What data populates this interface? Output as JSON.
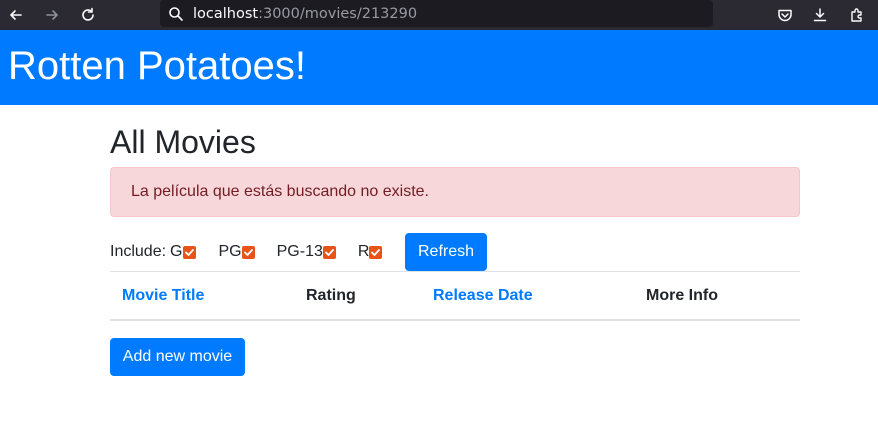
{
  "browser": {
    "url_host": "localhost",
    "url_rest": ":3000/movies/213290"
  },
  "header": {
    "title": "Rotten Potatoes!"
  },
  "main": {
    "page_title": "All Movies",
    "alert_message": "La película que estás buscando no existe.",
    "filter": {
      "label": "Include:",
      "ratings": [
        {
          "label": "G",
          "checked": true
        },
        {
          "label": "PG",
          "checked": true
        },
        {
          "label": "PG-13",
          "checked": true
        },
        {
          "label": "R",
          "checked": true
        }
      ],
      "refresh_label": "Refresh"
    },
    "table": {
      "columns": [
        {
          "label": "Movie Title",
          "sortable": true
        },
        {
          "label": "Rating",
          "sortable": false
        },
        {
          "label": "Release Date",
          "sortable": true
        },
        {
          "label": "More Info",
          "sortable": false
        }
      ],
      "rows": []
    },
    "add_movie_label": "Add new movie"
  },
  "colors": {
    "header_bg": "#007bff",
    "link": "#007bff",
    "alert_bg": "#f8d7da",
    "alert_text": "#721c24",
    "checkbox": "#e8531a",
    "browser_bg": "#2b2a33"
  }
}
